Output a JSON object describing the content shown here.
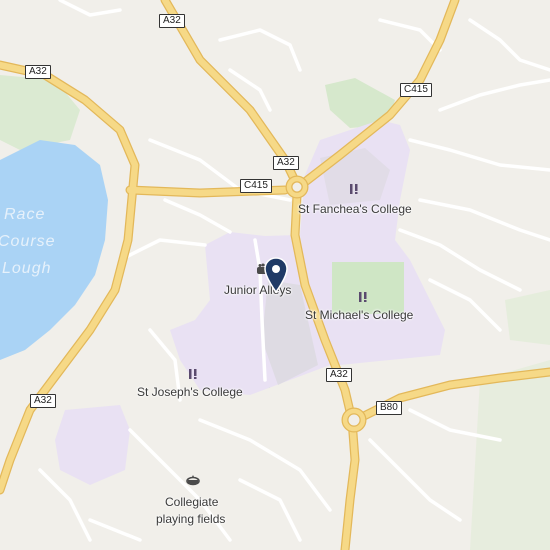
{
  "map": {
    "colors": {
      "background": "#f1efea",
      "water": "#aad3f5",
      "green": "#cde6c3",
      "institution": "#e7dff2",
      "road_major": "#f6d987",
      "road_major_edge": "#e3b85a",
      "road_minor": "#ffffff",
      "road_minor_edge": "#d8d4cc",
      "pin": "#1f3a66"
    },
    "road_labels": {
      "a32_top": "A32",
      "a32_upper_left": "A32",
      "c415_right": "C415",
      "a32_center": "A32",
      "c415_center": "C415",
      "a32_south": "A32",
      "b80": "B80",
      "a32_lower_left": "A32"
    },
    "lake": {
      "line1": "Race",
      "line2": "Course",
      "line3": "Lough"
    },
    "pois": {
      "st_fanchea": {
        "name": "St Fanchea's College",
        "icon": "school-icon"
      },
      "junior_alleys": {
        "name": "Junior Alleys",
        "icon": "bowling-icon"
      },
      "st_michael": {
        "name": "St Michael's College",
        "icon": "school-icon"
      },
      "st_joseph": {
        "name": "St Joseph's College",
        "icon": "school-icon"
      },
      "collegiate_fields": {
        "line1": "Collegiate",
        "line2": "playing fields",
        "icon": "stadium-icon"
      }
    },
    "marker": {
      "icon": "location-pin-icon"
    }
  }
}
